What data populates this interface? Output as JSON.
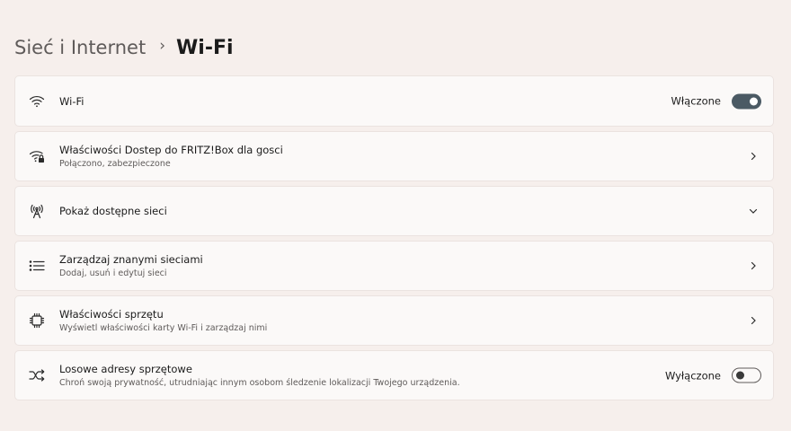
{
  "breadcrumb": {
    "parent": "Sieć i Internet",
    "separator": "›",
    "current": "Wi-Fi"
  },
  "rows": {
    "wifi": {
      "title": "Wi-Fi",
      "state": "Włączone",
      "icon": "wifi-icon"
    },
    "properties": {
      "title": "Właściwości Dostep do FRITZ!Box dla gosci",
      "subtitle": "Połączono, zabezpieczone",
      "icon": "wifi-lock-icon"
    },
    "show_networks": {
      "title": "Pokaż dostępne sieci",
      "icon": "antenna-icon"
    },
    "manage": {
      "title": "Zarządzaj znanymi sieciami",
      "subtitle": "Dodaj, usuń i edytuj sieci",
      "icon": "list-icon"
    },
    "hardware": {
      "title": "Właściwości sprzętu",
      "subtitle": "Wyświetl właściwości karty Wi-Fi i zarządzaj nimi",
      "icon": "chip-icon"
    },
    "random_mac": {
      "title": "Losowe adresy sprzętowe",
      "subtitle": "Chroń swoją prywatność, utrudniając innym osobom śledzenie lokalizacji Twojego urządzenia.",
      "state": "Wyłączone",
      "icon": "shuffle-icon"
    }
  },
  "toggles": {
    "wifi_on": true,
    "random_mac_on": false
  },
  "colors": {
    "background": "#f6efec",
    "card": "#fbf9f8",
    "toggle_on": "#4b5a64"
  }
}
